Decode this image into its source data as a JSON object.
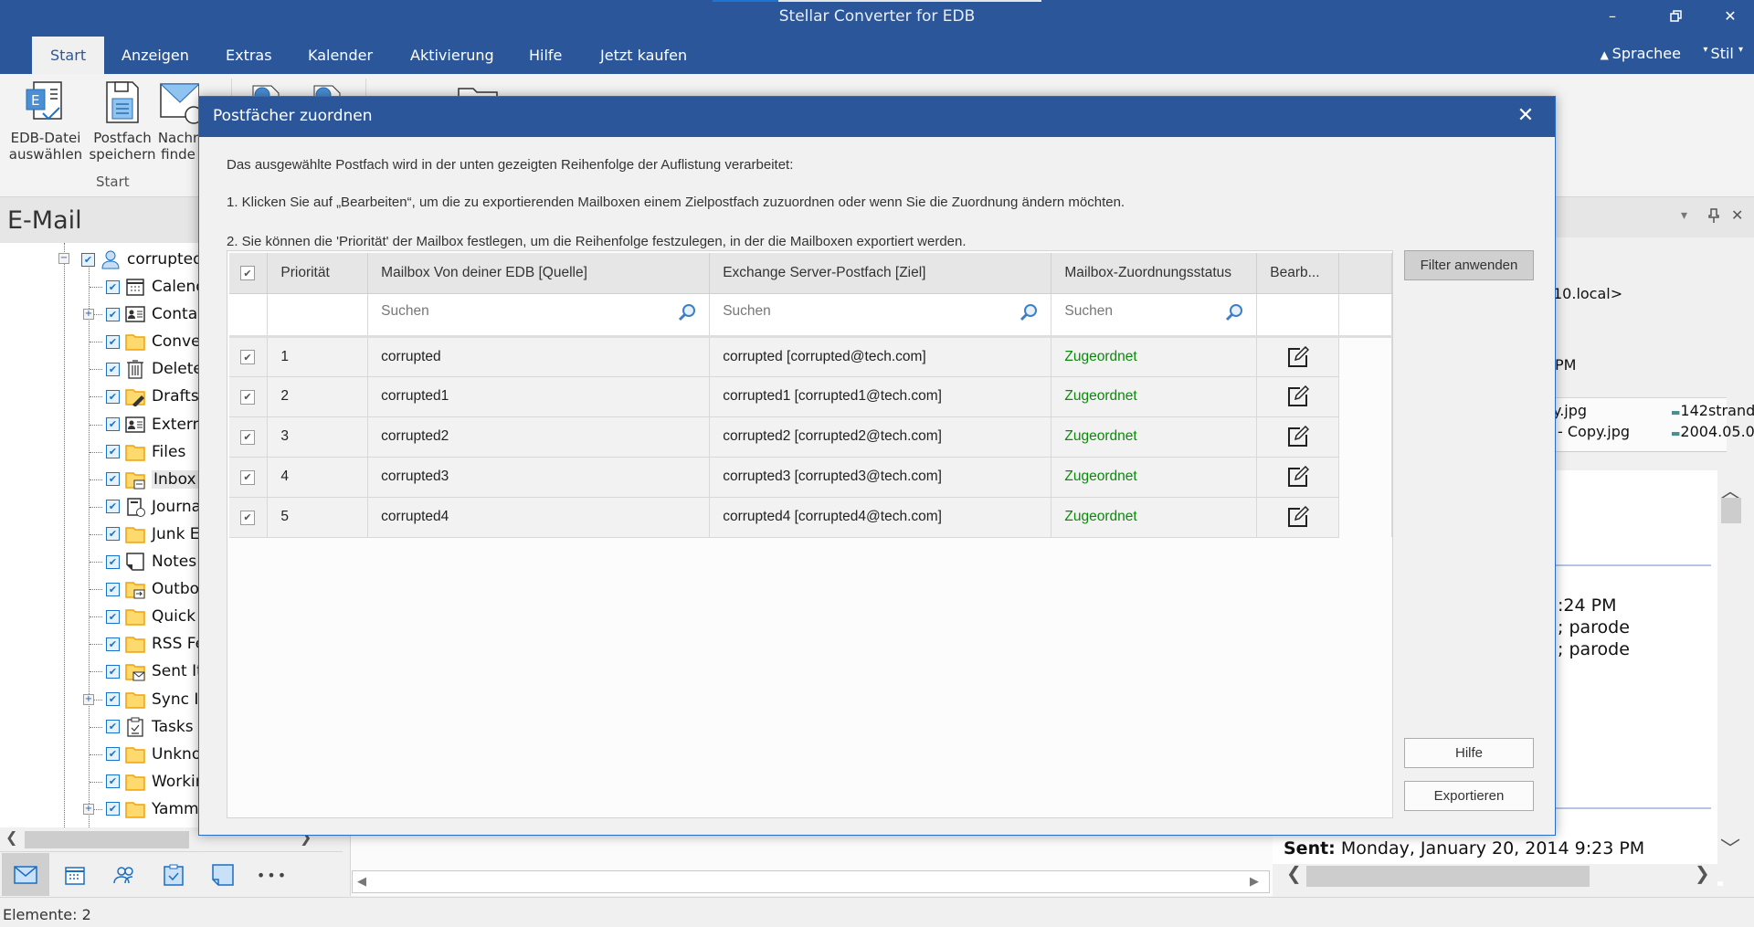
{
  "window": {
    "title": "Stellar Converter for EDB",
    "controls": {
      "minimize": "–",
      "restore": "🗗",
      "close": "✕"
    }
  },
  "menu": {
    "tabs": [
      {
        "label": "Start",
        "active": true
      },
      {
        "label": "Anzeigen"
      },
      {
        "label": "Extras"
      },
      {
        "label": "Kalender"
      },
      {
        "label": "Aktivierung"
      },
      {
        "label": "Hilfe"
      },
      {
        "label": "Jetzt kaufen"
      }
    ],
    "language": "Sprachee",
    "style": "Stil"
  },
  "ribbon": {
    "buttons": [
      {
        "line1": "EDB-Datei",
        "line2": "auswählen",
        "icon": "edb-file-icon"
      },
      {
        "line1": "Postfach",
        "line2": "speichern",
        "icon": "save-mailbox-icon"
      },
      {
        "line1": "Nachr",
        "line2": "finde",
        "icon": "find-message-icon"
      }
    ],
    "group_label": "Start"
  },
  "left_pane": {
    "title": "E-Mail",
    "root": "corrupted",
    "folders": [
      {
        "label": "Calend",
        "icon": "calendar-icon",
        "expandable": false
      },
      {
        "label": "Contac",
        "icon": "contacts-icon",
        "expandable": true
      },
      {
        "label": "Conver",
        "icon": "folder-icon",
        "expandable": false
      },
      {
        "label": "Delete",
        "icon": "trash-icon",
        "expandable": false
      },
      {
        "label": "Drafts",
        "icon": "drafts-folder-icon",
        "expandable": false
      },
      {
        "label": "Externa",
        "icon": "contacts-icon",
        "expandable": false
      },
      {
        "label": "Files",
        "icon": "folder-icon",
        "expandable": false
      },
      {
        "label": "Inbox",
        "icon": "inbox-folder-icon",
        "expandable": false,
        "selected": true
      },
      {
        "label": "Journa",
        "icon": "journal-icon",
        "expandable": false
      },
      {
        "label": "Junk Er",
        "icon": "folder-icon",
        "expandable": false
      },
      {
        "label": "Notes",
        "icon": "notes-icon",
        "expandable": false
      },
      {
        "label": "Outbo",
        "icon": "outbox-folder-icon",
        "expandable": false
      },
      {
        "label": "Quick S",
        "icon": "folder-icon",
        "expandable": false
      },
      {
        "label": "RSS Fe",
        "icon": "folder-icon",
        "expandable": false
      },
      {
        "label": "Sent It",
        "icon": "sent-folder-icon",
        "expandable": false
      },
      {
        "label": "Sync Is",
        "icon": "folder-icon",
        "expandable": true
      },
      {
        "label": "Tasks",
        "icon": "tasks-icon",
        "expandable": false
      },
      {
        "label": "Unkno",
        "icon": "folder-icon",
        "expandable": false
      },
      {
        "label": "Workir",
        "icon": "folder-icon",
        "expandable": false
      },
      {
        "label": "Yamm",
        "icon": "folder-icon",
        "expandable": true
      }
    ],
    "nav": [
      "mail-icon",
      "calendar-icon",
      "people-icon",
      "tasks-icon",
      "notes-icon",
      "more-icon"
    ],
    "more": "•••"
  },
  "status_bar": {
    "text": "Elemente: 2"
  },
  "right_pane": {
    "pane_controls": {
      "dropdown": "▾",
      "pin": "📌",
      "close": "✕"
    },
    "from_fragment": "10.local>",
    "time_fragment": "PM",
    "attachments": [
      {
        "name": "y.jpg",
        "other": "142strand"
      },
      {
        "name": "- Copy.jpg",
        "other": "2004.05.0"
      }
    ],
    "body_lines": [
      ":24 PM",
      "; parode",
      "; parode"
    ],
    "sent_label": "Sent:",
    "sent_value": "Monday, January 20, 2014 9:23 PM"
  },
  "dialog": {
    "title": "Postfächer zuordnen",
    "close": "✕",
    "instructions": [
      "Das ausgewählte Postfach wird in der unten gezeigten Reihenfolge der Auflistung verarbeitet:",
      "1. Klicken Sie auf „Bearbeiten“, um die zu exportierenden Mailboxen einem Zielpostfach zuzuordnen oder wenn Sie die Zuordnung ändern möchten.",
      "2. Sie können die 'Priorität' der Mailbox festlegen, um die Reihenfolge festzulegen, in der die Mailboxen exportiert werden."
    ],
    "table": {
      "headers": [
        "Priorität",
        "Mailbox Von deiner EDB [Quelle]",
        "Exchange Server-Postfach [Ziel]",
        "Mailbox-Zuordnungsstatus",
        "Bearb..."
      ],
      "search_placeholder": "Suchen",
      "rows": [
        {
          "checked": true,
          "priority": "1",
          "source": "corrupted",
          "target": "corrupted [corrupted@tech.com]",
          "status": "Zugeordnet"
        },
        {
          "checked": true,
          "priority": "2",
          "source": "corrupted1",
          "target": "corrupted1 [corrupted1@tech.com]",
          "status": "Zugeordnet"
        },
        {
          "checked": true,
          "priority": "3",
          "source": "corrupted2",
          "target": "corrupted2 [corrupted2@tech.com]",
          "status": "Zugeordnet"
        },
        {
          "checked": true,
          "priority": "4",
          "source": "corrupted3",
          "target": "corrupted3 [corrupted3@tech.com]",
          "status": "Zugeordnet"
        },
        {
          "checked": true,
          "priority": "5",
          "source": "corrupted4",
          "target": "corrupted4 [corrupted4@tech.com]",
          "status": "Zugeordnet"
        }
      ]
    },
    "buttons": {
      "filter": "Filter anwenden",
      "help": "Hilfe",
      "export": "Exportieren"
    },
    "colors": {
      "status_ok": "#0a8a0a",
      "titlebar": "#2b579a"
    }
  }
}
